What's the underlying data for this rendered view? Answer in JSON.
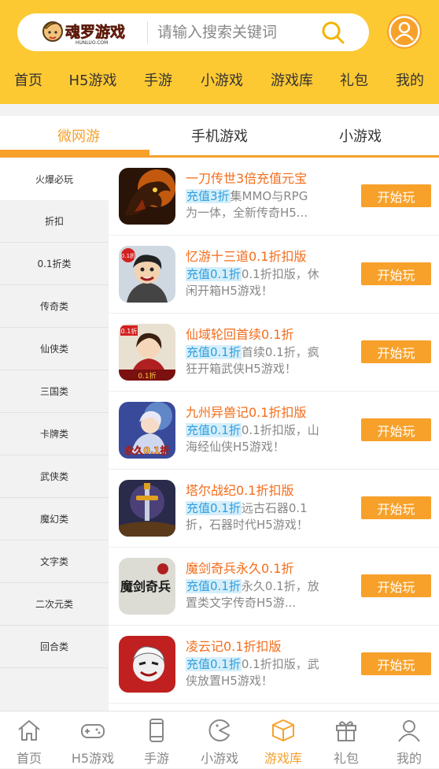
{
  "header": {
    "logo_text": "魂罗游戏",
    "logo_subtext": "HUNLUO.COM",
    "search_placeholder": "请输入搜索关键词"
  },
  "topnav": [
    "首页",
    "H5游戏",
    "手游",
    "小游戏",
    "游戏库",
    "礼包",
    "我的"
  ],
  "tabs": [
    "微网游",
    "手机游戏",
    "小游戏"
  ],
  "active_tab": 0,
  "sidebar": [
    "火爆必玩",
    "折扣",
    "0.1折类",
    "传奇类",
    "仙侠类",
    "三国类",
    "卡牌类",
    "武侠类",
    "魔幻类",
    "文字类",
    "二次元类",
    "回合类"
  ],
  "games": [
    {
      "title": "一刀传世3倍充值元宝",
      "badge": "充值3折",
      "desc": "集MMO与RPG为一体，全新传奇H5...",
      "button": "开始玩",
      "icon_text": ""
    },
    {
      "title": "忆游十三道0.1折扣版",
      "badge": "充值0.1折",
      "desc": "0.1折扣版，休闲开箱H5游戏！",
      "button": "开始玩",
      "icon_text": "0.1折"
    },
    {
      "title": "仙域轮回首续0.1折",
      "badge": "充值0.1折",
      "desc": "首续0.1折，疯狂开箱武侠H5游戏！",
      "button": "开始玩",
      "icon_text": "0.1折"
    },
    {
      "title": "九州异兽记0.1折扣版",
      "badge": "充值0.1折",
      "desc": "0.1折扣版，山海经仙侠H5游戏！",
      "button": "开始玩",
      "icon_text": "永久0.1折"
    },
    {
      "title": "塔尔战纪0.1折扣版",
      "badge": "充值0.1折",
      "desc": "远古石器0.1折，石器时代H5游戏！",
      "button": "开始玩",
      "icon_text": ""
    },
    {
      "title": "魔剑奇兵永久0.1折",
      "badge": "充值0.1折",
      "desc": "永久0.1折，放置类文字传奇H5游...",
      "button": "开始玩",
      "icon_text": "魔剑奇兵"
    },
    {
      "title": "凌云记0.1折扣版",
      "badge": "充值0.1折",
      "desc": "0.1折扣版，武侠放置H5游戏！",
      "button": "开始玩",
      "icon_text": ""
    }
  ],
  "bottomnav": [
    {
      "label": "首页",
      "icon": "home-icon"
    },
    {
      "label": "H5游戏",
      "icon": "gamepad-icon"
    },
    {
      "label": "手游",
      "icon": "phone-icon"
    },
    {
      "label": "小游戏",
      "icon": "pacman-icon"
    },
    {
      "label": "游戏库",
      "icon": "box-icon"
    },
    {
      "label": "礼包",
      "icon": "gift-icon"
    },
    {
      "label": "我的",
      "icon": "user-icon"
    }
  ],
  "active_bottom": 4,
  "colors": {
    "accent": "#f7a12b",
    "header": "#fdc933",
    "title": "#f46c1a",
    "badge": "#2e9fe0"
  }
}
